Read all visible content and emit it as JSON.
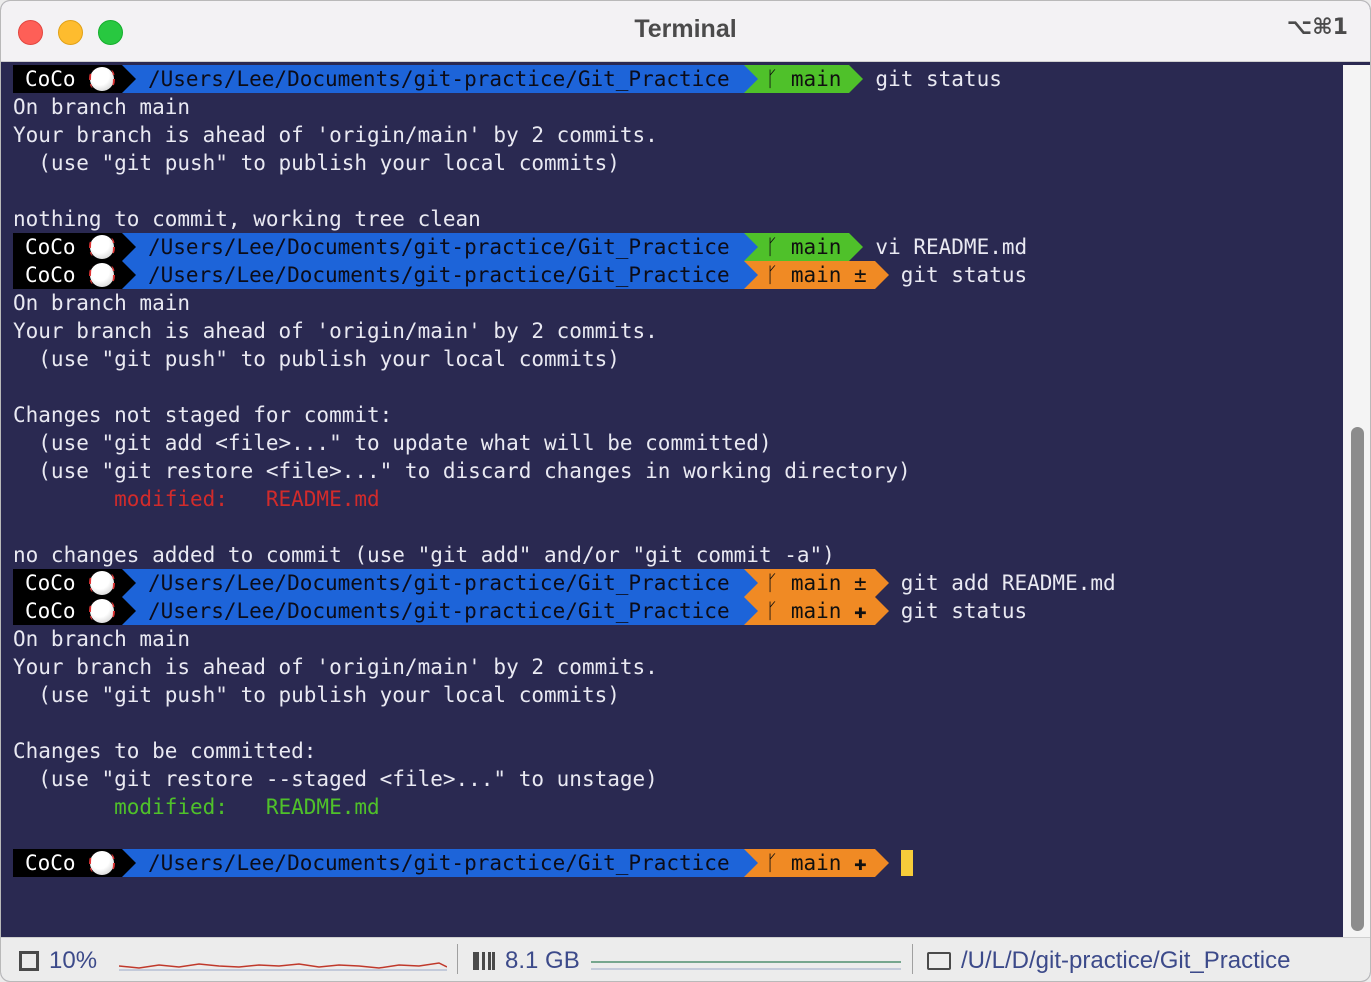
{
  "window": {
    "title": "Terminal",
    "shortcut": "⌥⌘1"
  },
  "prompt": {
    "user": "CoCo",
    "path": "/Users/Lee/Documents/git-practice/Git_Practice",
    "branch_icon": "git-branch-icon"
  },
  "prompts": [
    {
      "branch": "main",
      "state": "clean",
      "command": "git status"
    },
    {
      "branch": "main",
      "state": "clean",
      "command": "vi README.md"
    },
    {
      "branch": "main ±",
      "state": "dirty",
      "command": "git status"
    },
    {
      "branch": "main ±",
      "state": "dirty",
      "command": "git add README.md"
    },
    {
      "branch": "main ✚",
      "state": "staged",
      "command": "git status"
    },
    {
      "branch": "main ✚",
      "state": "staged",
      "command": ""
    }
  ],
  "output": {
    "o1": "On branch main",
    "o2": "Your branch is ahead of 'origin/main' by 2 commits.",
    "o3": "  (use \"git push\" to publish your local commits)",
    "o4": "nothing to commit, working tree clean",
    "o5": "On branch main",
    "o6": "Your branch is ahead of 'origin/main' by 2 commits.",
    "o7": "  (use \"git push\" to publish your local commits)",
    "o8": "Changes not staged for commit:",
    "o9": "  (use \"git add <file>...\" to update what will be committed)",
    "o10": "  (use \"git restore <file>...\" to discard changes in working directory)",
    "o11": "        modified:   README.md",
    "o12": "no changes added to commit (use \"git add\" and/or \"git commit -a\")",
    "o13": "On branch main",
    "o14": "Your branch is ahead of 'origin/main' by 2 commits.",
    "o15": "  (use \"git push\" to publish your local commits)",
    "o16": "Changes to be committed:",
    "o17": "  (use \"git restore --staged <file>...\" to unstage)",
    "o18": "        modified:   README.md"
  },
  "status": {
    "cpu": "10%",
    "memory": "8.1 GB",
    "directory": "/U/L/D/git-practice/Git_Practice"
  },
  "colors": {
    "background": "#2a2951",
    "path_segment": "#1d64d9",
    "git_clean": "#4fc12a",
    "git_dirty": "#f08a24",
    "modified_unstaged": "#d12b2b",
    "modified_staged": "#4fc12a",
    "cursor": "#f7cc3a"
  }
}
